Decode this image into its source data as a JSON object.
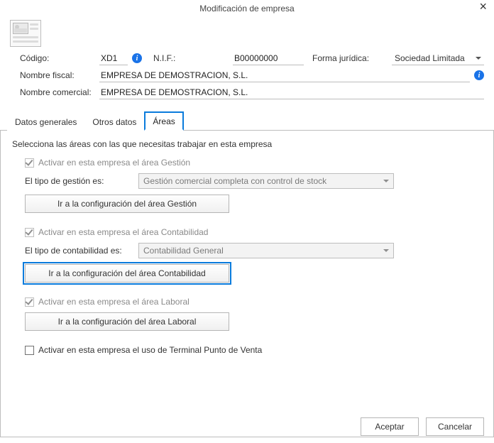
{
  "window": {
    "title": "Modificación de empresa"
  },
  "header": {
    "codigo_label": "Código:",
    "codigo_value": "XD1",
    "nif_label": "N.I.F.:",
    "nif_value": "B00000000",
    "forma_label": "Forma jurídica:",
    "forma_value": "Sociedad Limitada",
    "nombre_fiscal_label": "Nombre fiscal:",
    "nombre_fiscal_value": "EMPRESA DE DEMOSTRACION, S.L.",
    "nombre_comercial_label": "Nombre comercial:",
    "nombre_comercial_value": "EMPRESA DE DEMOSTRACION, S.L."
  },
  "tabs": {
    "general": "Datos generales",
    "otros": "Otros datos",
    "areas": "Áreas"
  },
  "areas": {
    "intro": "Selecciona las áreas con las que necesitas trabajar en esta empresa",
    "gestion": {
      "checkbox": "Activar en esta empresa el área Gestión",
      "tipo_label": "El tipo de gestión es:",
      "tipo_value": "Gestión comercial completa con control de stock",
      "config_btn": "Ir a la configuración del área Gestión"
    },
    "contabilidad": {
      "checkbox": "Activar en esta empresa el área Contabilidad",
      "tipo_label": "El tipo de contabilidad es:",
      "tipo_value": "Contabilidad General",
      "config_btn": "Ir a la configuración del área Contabilidad"
    },
    "laboral": {
      "checkbox": "Activar en esta empresa el área Laboral",
      "config_btn": "Ir a la configuración del área Laboral"
    },
    "tpv": {
      "checkbox": "Activar en esta empresa el uso de Terminal Punto de Venta"
    }
  },
  "footer": {
    "accept": "Aceptar",
    "cancel": "Cancelar"
  }
}
